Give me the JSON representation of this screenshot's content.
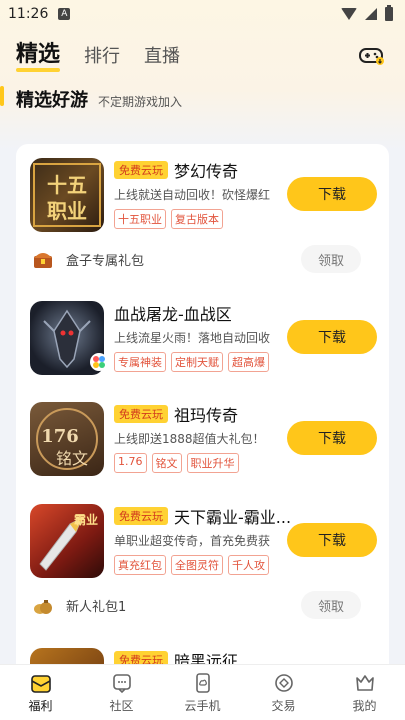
{
  "status_bar": {
    "time": "11:26",
    "a_badge": "A"
  },
  "top_nav": {
    "tabs": [
      {
        "label": "精选",
        "active": true
      },
      {
        "label": "排行",
        "active": false
      },
      {
        "label": "直播",
        "active": false
      }
    ],
    "gamepad_icon": "gamepad-icon"
  },
  "section": {
    "title": "精选好游",
    "subtitle": "不定期游戏加入"
  },
  "games": [
    {
      "icon_text": "十五职业",
      "cloud_badge": "免费云玩",
      "name": "梦幻传奇",
      "desc": "上线就送自动回收！砍怪爆红",
      "tags": [
        "十五职业",
        "复古版本"
      ],
      "button": "下载"
    },
    {
      "icon_text": "",
      "cloud_badge": "",
      "name": "血战屠龙-血战区",
      "desc": "上线流星火雨！落地自动回收",
      "tags": [
        "专属神装",
        "定制天赋",
        "超高爆"
      ],
      "button": "下载"
    },
    {
      "icon_text": "1.76铭文",
      "cloud_badge": "免费云玩",
      "name": "祖玛传奇",
      "desc": "上线即送1888超值大礼包！",
      "tags": [
        "1.76",
        "铭文",
        "职业升华"
      ],
      "button": "下载"
    },
    {
      "icon_text": "霸业",
      "cloud_badge": "免费云玩",
      "name": "天下霸业-霸业...",
      "desc": "单职业超变传奇，首充免费获",
      "tags": [
        "真充红包",
        "全图灵符",
        "千人攻"
      ],
      "button": "下载"
    },
    {
      "icon_text": "",
      "cloud_badge": "免费云玩",
      "name": "暗黑远征",
      "desc": "",
      "tags": [],
      "button": "下载"
    }
  ],
  "gifts": [
    {
      "label": "盒子专属礼包",
      "button": "领取"
    },
    {
      "label": "新人礼包1",
      "button": "领取"
    }
  ],
  "bottom_nav": [
    {
      "label": "福利",
      "icon": "welfare-icon",
      "active": true
    },
    {
      "label": "社区",
      "icon": "community-icon",
      "active": false
    },
    {
      "label": "云手机",
      "icon": "cloud-phone-icon",
      "active": false
    },
    {
      "label": "交易",
      "icon": "trade-icon",
      "active": false
    },
    {
      "label": "我的",
      "icon": "profile-icon",
      "active": false
    }
  ],
  "colors": {
    "accent": "#ffc61a",
    "tag_red": "#e2533b"
  }
}
